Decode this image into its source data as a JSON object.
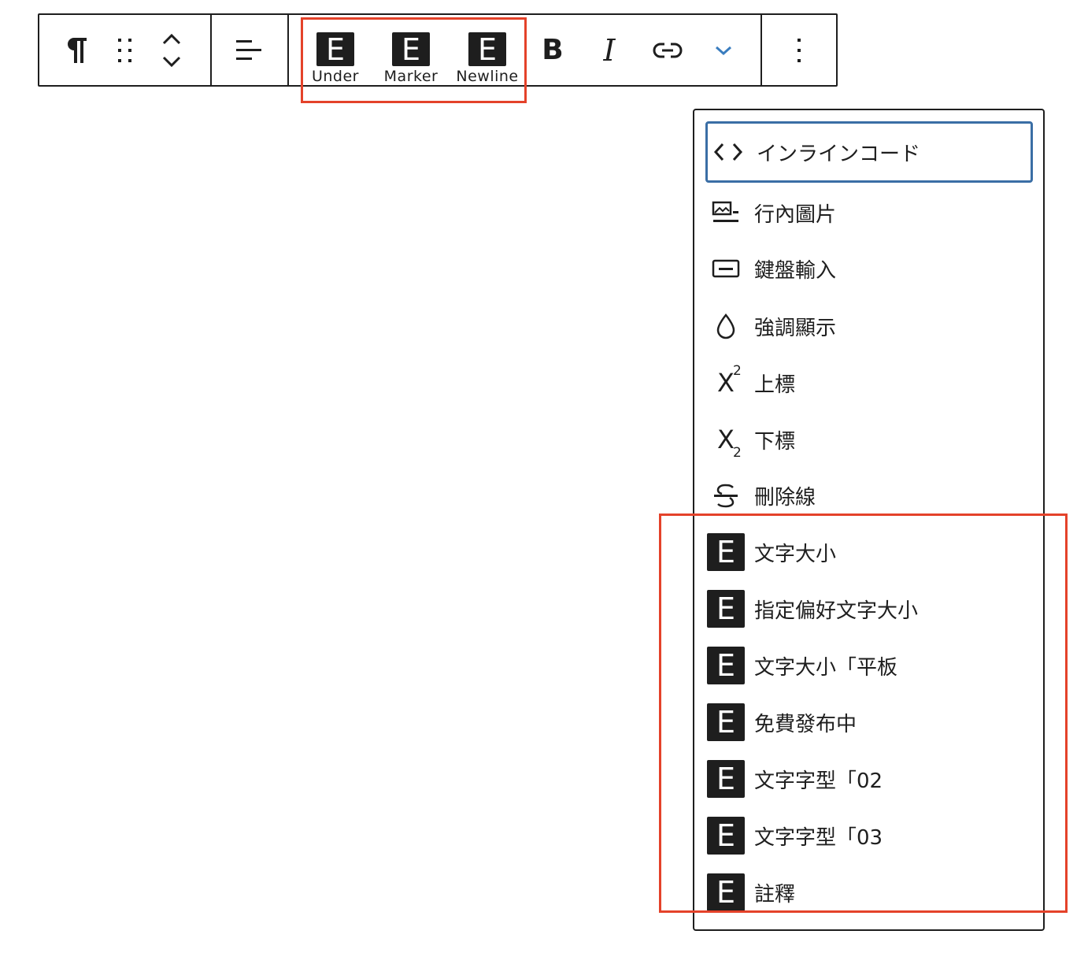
{
  "toolbar": {
    "paragraph_icon": "pilcrow-icon",
    "custom_formats": [
      {
        "glyph": "E",
        "label": "Under"
      },
      {
        "glyph": "E",
        "label": "Marker"
      },
      {
        "glyph": "E",
        "label": "Newline"
      }
    ],
    "bold_glyph": "B",
    "italic_glyph": "I"
  },
  "menu": {
    "items": [
      {
        "label": "インラインコード",
        "icon": "code-icon"
      },
      {
        "label": "行內圖片",
        "icon": "inline-image-icon"
      },
      {
        "label": "鍵盤輸入",
        "icon": "keyboard-icon"
      },
      {
        "label": "強調顯示",
        "icon": "highlight-drop-icon"
      },
      {
        "label": "上標",
        "icon": "superscript-icon",
        "base": "X",
        "mark": "2"
      },
      {
        "label": "下標",
        "icon": "subscript-icon",
        "base": "X",
        "mark": "2"
      },
      {
        "label": "刪除線",
        "icon": "strikethrough-icon"
      },
      {
        "label": "文字大小",
        "icon": "e-format-icon",
        "glyph": "E"
      },
      {
        "label": "指定偏好文字大小",
        "icon": "e-format-icon",
        "glyph": "E"
      },
      {
        "label": "文字大小「平板",
        "icon": "e-format-icon",
        "glyph": "E"
      },
      {
        "label": "免費發布中",
        "icon": "e-format-icon",
        "glyph": "E"
      },
      {
        "label": "文字字型「02",
        "icon": "e-format-icon",
        "glyph": "E"
      },
      {
        "label": "文字字型「03",
        "icon": "e-format-icon",
        "glyph": "E"
      },
      {
        "label": "註釋",
        "icon": "e-format-icon",
        "glyph": "E"
      }
    ]
  },
  "colors": {
    "highlight": "#e4422a",
    "focus": "#3a6ea5",
    "chevron": "#3a7dbf",
    "dark": "#1e1e1e"
  }
}
